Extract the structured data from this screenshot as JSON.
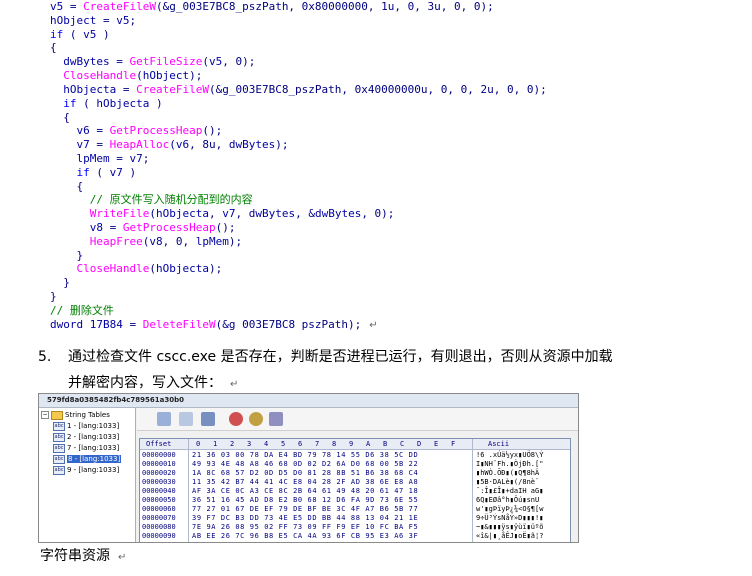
{
  "code": [
    "v5 = CreateFileW(&g_003E7BC8_pszPath, 0x80000000, 1u, 0, 3u, 0, 0);",
    "hObject = v5;",
    "if ( v5 )",
    "{",
    "  dwBytes = GetFileSize(v5, 0);",
    "  CloseHandle(hObject);",
    "  hObjecta = CreateFileW(&g_003E7BC8_pszPath, 0x40000000u, 0, 0, 2u, 0, 0);",
    "  if ( hObjecta )",
    "  {",
    "    v6 = GetProcessHeap();",
    "    v7 = HeapAlloc(v6, 8u, dwBytes);",
    "    lpMem = v7;",
    "    if ( v7 )",
    "    {",
    "      // 原文件写入随机分配到的内容",
    "      WriteFile(hObjecta, v7, dwBytes, &dwBytes, 0);",
    "      v8 = GetProcessHeap();",
    "      HeapFree(v8, 0, lpMem);",
    "    }",
    "    CloseHandle(hObjecta);",
    "  }",
    "}",
    "// 删除文件",
    "dword 17B84 = DeleteFileW(&g 003E7BC8 pszPath);"
  ],
  "paragraph_mark": "↵",
  "step": {
    "number": "5.",
    "line1": "通过检查文件 cscc.exe 是否存在，判断是否进程已运行，有则退出，否则从资源中加载",
    "line2": "并解密内容，写入文件："
  },
  "screenshot": {
    "title": "579fd8a0385482fb4c789561a30b0",
    "tree_root": "String Tables",
    "tree_items": [
      "1 - [lang:1033]",
      "2 - [lang:1033]",
      "7 - [lang:1033]",
      "8 - [lang:1033]",
      "9 - [lang:1033]"
    ],
    "hex_header_offset": "Offset",
    "hex_header_cols": [
      "0",
      "1",
      "2",
      "3",
      "4",
      "5",
      "6",
      "7",
      "8",
      "9",
      "A",
      "B",
      "C",
      "D",
      "E",
      "F"
    ],
    "hex_header_ascii": "Ascii",
    "hex_rows": [
      {
        "off": "00000000",
        "bytes": "21 36 03 00 78 DA E4 BD 79 78 14 55 D6 38 5C DD",
        "ascii": "!6 .xÚä½yx▮UÖ8\\Ý"
      },
      {
        "off": "00000010",
        "bytes": "49 93 4E 48 A8 46 68 0D 02 D2 6A D0 68 00 5B 22",
        "ascii": "I▮NH¨Fh.▮ÒjÐh.[\""
      },
      {
        "off": "00000020",
        "bytes": "1A 8C 68 57 D2 0D D5 D0 81 28 8B 51 B6 38 68 C4",
        "ascii": "▮hWÒ.ÕÐ▮(▮Q¶8hÄ"
      },
      {
        "off": "00000030",
        "bytes": "11 35 42 B7 44 41 4C E8 04 28 2F AD 38 6E E8 A8",
        "ascii": "▮5B·DALè▮(/­8nè¨"
      },
      {
        "off": "00000040",
        "bytes": "AF 3A CE 0C A3 CE 8C 2B 64 61 49 48 20 61 47 18",
        "ascii": "¯:Î▮£Î▮+daIH aG▮"
      },
      {
        "off": "00000050",
        "bytes": "36 51 16 45 AD D8 E2 B0 68 12 D6 FA 9D 73 6E 55",
        "ascii": "6Q▮E­Øâ°h▮Öú▮snU"
      },
      {
        "off": "00000060",
        "bytes": "77 27 01 67 DE EF 79 DE BF BE 3C 4F A7 B6 5B 77",
        "ascii": "w'▮gÞïyÞ¿¾<O§¶[w"
      },
      {
        "off": "00000070",
        "bytes": "39 F7 DC B3 DD 73 4E E5 DD BB 44 88 13 04 21 1E",
        "ascii": "9÷Ü³ÝsNåÝ»D▮▮▮!▮"
      },
      {
        "off": "00000080",
        "bytes": "7E 9A 26 08 95 02 FF 73 09 FF F9 EF 10 FC BA F5",
        "ascii": "~▮&▮▮▮ÿs▮ÿùï▮üºõ"
      },
      {
        "off": "00000090",
        "bytes": "AB EE 26 7C 96 B8 E5 CA 4A 93 6F CB 95 E3 A6 3F",
        "ascii": "«î&|▮¸åÊJ▮oË▮ã¦?"
      }
    ]
  },
  "caption": "字符串资源"
}
